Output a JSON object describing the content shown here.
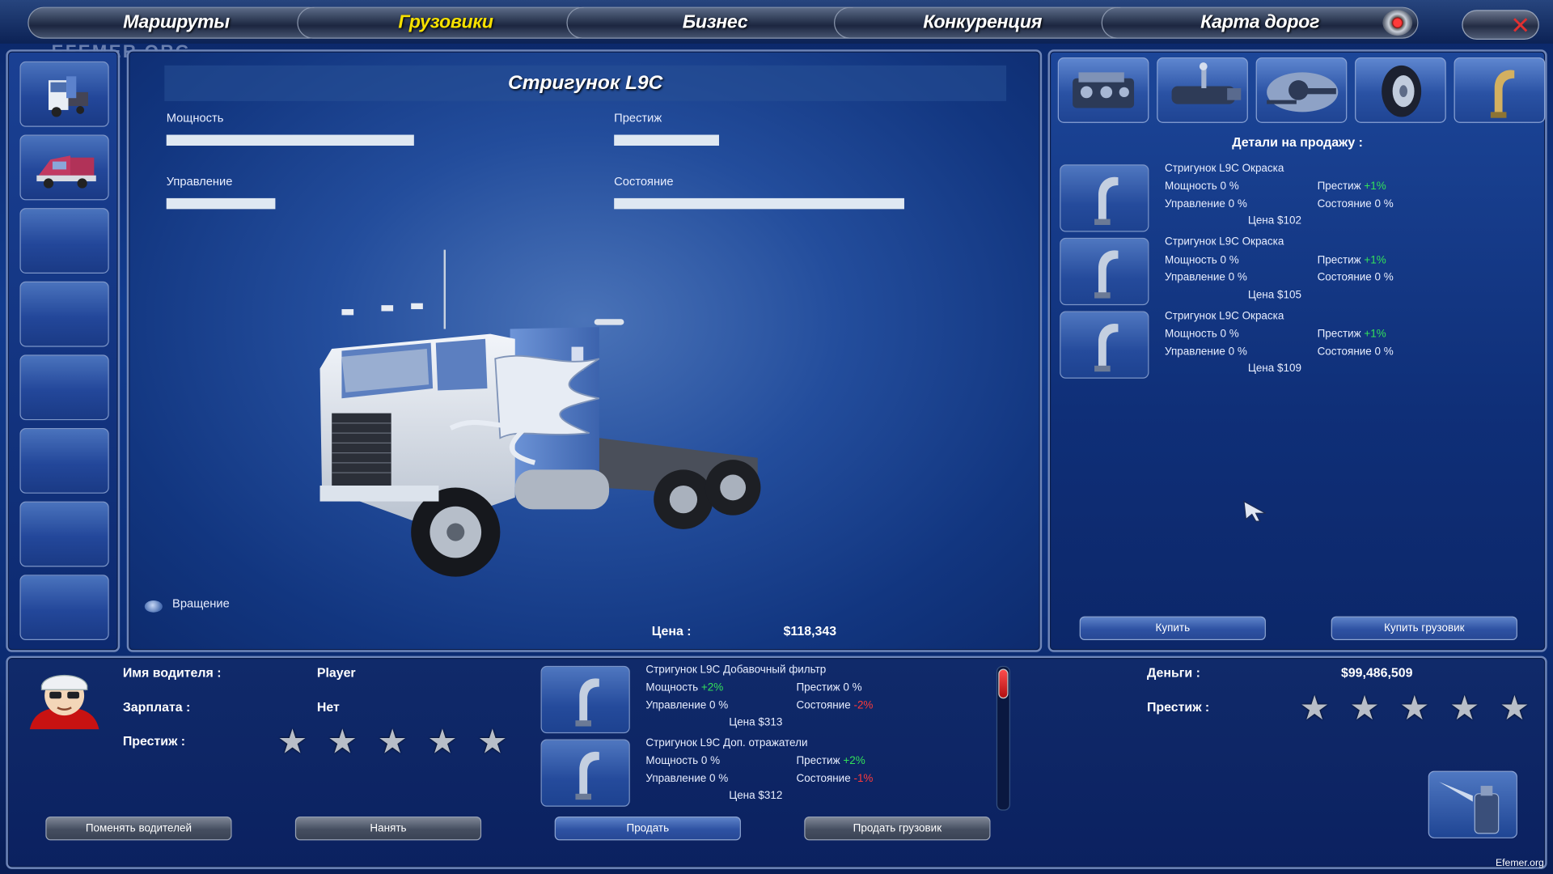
{
  "nav": {
    "tabs": [
      {
        "label": "Маршруты",
        "active": false
      },
      {
        "label": "Грузовики",
        "active": true
      },
      {
        "label": "Бизнес",
        "active": false
      },
      {
        "label": "Конкуренция",
        "active": false
      },
      {
        "label": "Карта дорог",
        "active": false
      }
    ],
    "active_color": "#f5e000"
  },
  "watermark": "EFEMER.ORG",
  "truck": {
    "title": "Стригунок L9C",
    "stats": [
      {
        "label": "Мощность",
        "value_pct": 52
      },
      {
        "label": "Престиж",
        "value_pct": 22
      },
      {
        "label": "Управление",
        "value_pct": 23
      },
      {
        "label": "Состояние",
        "value_pct": 61
      }
    ],
    "rotate_label": "Вращение",
    "price_label": "Цена :",
    "price_value": "$118,343"
  },
  "shop": {
    "part_categories": [
      "engine-icon",
      "transmission-icon",
      "chassis-icon",
      "wheel-icon",
      "exhaust-icon"
    ],
    "header": "Детали на продажу :",
    "items": [
      {
        "name": "Стригунок L9C Окраска",
        "power": "Мощность 0 %",
        "prestige_label": "Престиж",
        "prestige_val": "+1%",
        "control": "Управление 0 %",
        "condition": "Состояние 0 %",
        "price": "Цена $102"
      },
      {
        "name": "Стригунок L9C Окраска",
        "power": "Мощность 0 %",
        "prestige_label": "Престиж",
        "prestige_val": "+1%",
        "control": "Управление 0 %",
        "condition": "Состояние 0 %",
        "price": "Цена $105"
      },
      {
        "name": "Стригунок L9C Окраска",
        "power": "Мощность 0 %",
        "prestige_label": "Престиж",
        "prestige_val": "+1%",
        "control": "Управление 0 %",
        "condition": "Состояние 0 %",
        "price": "Цена $109"
      }
    ],
    "buy_label": "Купить",
    "buy_truck_label": "Купить грузовик"
  },
  "driver": {
    "name_label": "Имя водителя :",
    "name_value": "Player",
    "salary_label": "Зарплата :",
    "salary_value": "Нет",
    "prestige_label": "Престиж :",
    "prestige_stars": 5,
    "change_label": "Поменять водителей",
    "hire_label": "Нанять"
  },
  "installed": {
    "items": [
      {
        "name": "Стригунок L9C Добавочный фильтр",
        "power_label": "Мощность",
        "power_val": "+2%",
        "prestige": "Престиж 0 %",
        "control": "Управление 0 %",
        "condition_label": "Состояние",
        "condition_val": "-2%",
        "price": "Цена $313"
      },
      {
        "name": "Стригунок L9C Доп. отражатели",
        "power_label": "Мощность",
        "power_val": "0 %",
        "prestige": "Престиж",
        "prestige_val": "+2%",
        "control": "Управление 0 %",
        "condition_label": "Состояние",
        "condition_val": "-1%",
        "price": "Цена $312"
      }
    ],
    "sell_label": "Продать",
    "sell_truck_label": "Продать грузовик"
  },
  "account": {
    "money_label": "Деньги :",
    "money_value": "$99,486,509",
    "prestige_label": "Престиж :",
    "prestige_stars": 5
  },
  "site_note": "Efemer.org",
  "colors": {
    "positive": "#33e05a",
    "negative": "#ff3a3a",
    "background": "#0d2f78"
  }
}
